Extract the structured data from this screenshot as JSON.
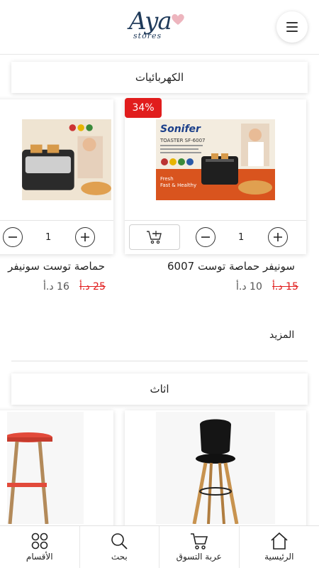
{
  "header": {
    "logo_text": "Aya",
    "logo_sub": "stores",
    "menu_icon": "hamburger-menu-icon"
  },
  "sections": [
    {
      "title": "الكهربائيات",
      "products": [
        {
          "name": "سونيفر حماصة توست 6007",
          "price_new": "10 د.أ",
          "price_old": "15 د.أ",
          "discount": "34%",
          "qty": "1"
        },
        {
          "name": "حماصة توست سونيفر",
          "price_new": "16 د.أ",
          "price_old": "25 د.أ",
          "qty": "1"
        }
      ],
      "more_label": "المزيد"
    },
    {
      "title": "اثاث",
      "products": [
        {
          "name": "",
          "image": "black-bar-stool"
        },
        {
          "name": "",
          "image": "red-bar-stool"
        }
      ]
    }
  ],
  "bottom_nav": [
    {
      "label": "الرئيسية",
      "icon": "home-icon"
    },
    {
      "label": "عربة التسوق",
      "icon": "cart-icon"
    },
    {
      "label": "بحث",
      "icon": "search-icon"
    },
    {
      "label": "الأقسام",
      "icon": "categories-grid-icon"
    }
  ],
  "colors": {
    "accent_red": "#e11d1d",
    "logo_blue": "#1f3a5a"
  }
}
